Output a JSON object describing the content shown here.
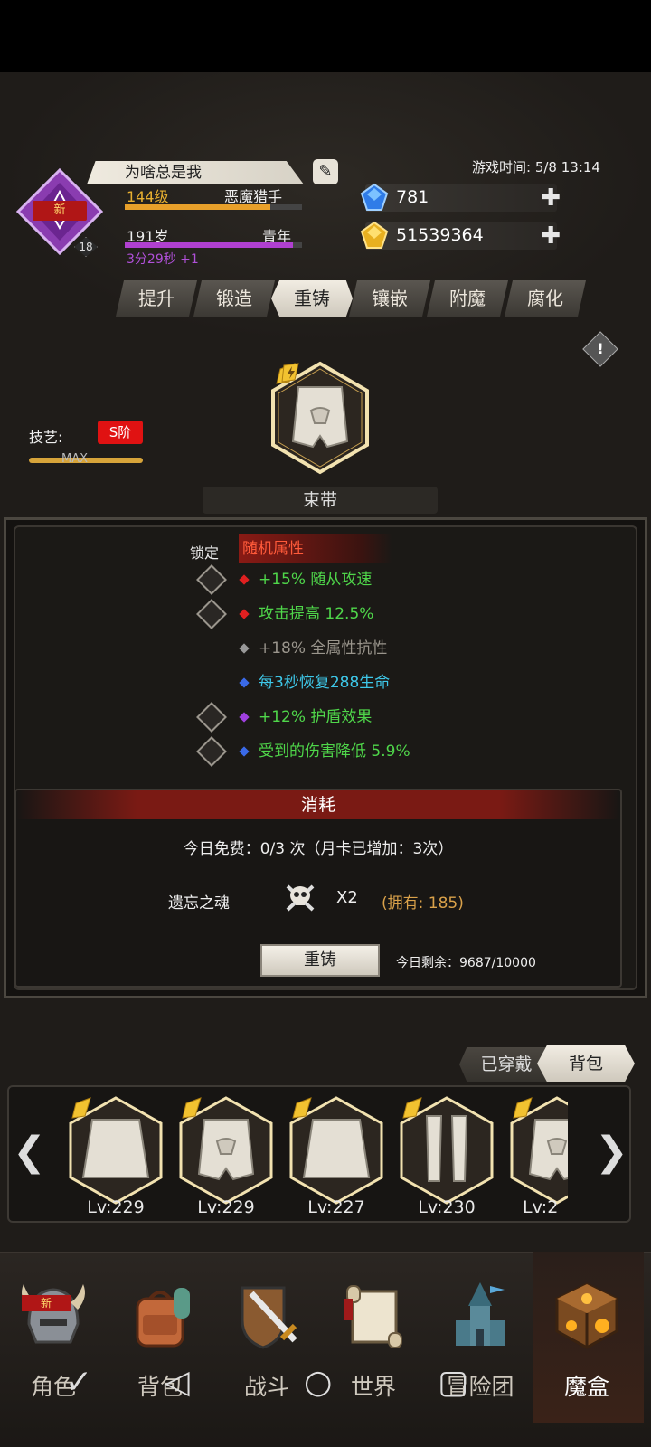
{
  "header": {
    "player_name": "为啥总是我",
    "new_badge": "新",
    "avatar_level": "18",
    "level_text": "144级",
    "class_name": "恶魔猎手",
    "age_text": "191岁",
    "age_stage": "青年",
    "timer_text": "3分29秒 +1",
    "game_time": "游戏时间: 5/8 13:14",
    "gems": "781",
    "gold": "51539364",
    "level_progress": 0.82,
    "age_progress": 0.95
  },
  "tabs": [
    "提升",
    "锻造",
    "重铸",
    "镶嵌",
    "附魔",
    "腐化"
  ],
  "active_tab": "重铸",
  "skill": {
    "label": "技艺:",
    "tier": "S阶",
    "max_text": "MAX"
  },
  "item": {
    "name": "束带"
  },
  "attributes": {
    "lock_label": "锁定",
    "title": "随机属性",
    "rows": [
      {
        "text": "+15% 随从攻速",
        "color": "#4fd64a",
        "dot": "#e02020",
        "lock": true
      },
      {
        "text": "攻击提高 12.5%",
        "color": "#4fd64a",
        "dot": "#e02020",
        "lock": true
      },
      {
        "text": "+18% 全属性抗性",
        "color": "#9a958c",
        "dot": "#999999",
        "lock": false
      },
      {
        "text": "每3秒恢复288生命",
        "color": "#3ec7e8",
        "dot": "#3a6ae8",
        "lock": false
      },
      {
        "text": "+12% 护盾效果",
        "color": "#4fd64a",
        "dot": "#a040e0",
        "lock": true
      },
      {
        "text": "受到的伤害降低 5.9%",
        "color": "#4fd64a",
        "dot": "#3a6ae8",
        "lock": true
      }
    ]
  },
  "consume": {
    "title": "消耗",
    "free_text": "今日免费：0/3 次（月卡已增加：3次）",
    "material_name": "遗忘之魂",
    "material_count": "X2",
    "owned": "(拥有: 185)",
    "recast_button": "重铸",
    "remaining": "今日剩余：9687/10000"
  },
  "inventory": {
    "tab_equipped": "已穿戴",
    "tab_backpack": "背包",
    "items": [
      {
        "lv": "Lv:229",
        "kind": "skirt"
      },
      {
        "lv": "Lv:229",
        "kind": "belt"
      },
      {
        "lv": "Lv:227",
        "kind": "skirt"
      },
      {
        "lv": "Lv:230",
        "kind": "legs"
      },
      {
        "lv": "Lv:2",
        "kind": "belt"
      }
    ]
  },
  "nav": {
    "items": [
      "角色",
      "背包",
      "战斗",
      "世界",
      "冒险团",
      "魔盒"
    ],
    "active": "魔盒",
    "new_badge": "新"
  },
  "colors": {
    "accent_gold": "#d7a43a",
    "tier_red": "#e01212",
    "green_stat": "#4fd64a",
    "cyan_stat": "#3ec7e8"
  }
}
